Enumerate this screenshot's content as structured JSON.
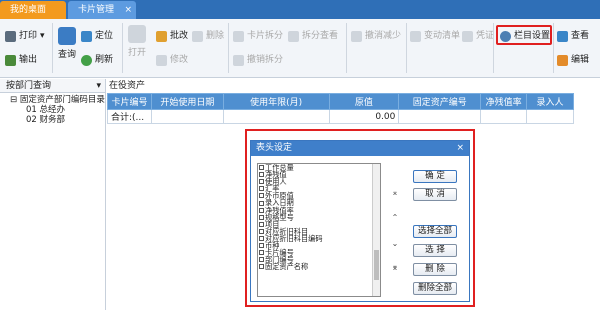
{
  "tabs": [
    {
      "label": "我的桌面"
    },
    {
      "label": "卡片管理",
      "close": "×"
    }
  ],
  "toolbar": {
    "print": "打印",
    "print_arrow": "▾",
    "output": "输出",
    "query": "查询",
    "locate": "定位",
    "refresh": "刷新",
    "open": "打开",
    "batch_edit": "批改",
    "modify": "修改",
    "delete": "删除",
    "card_split": "卡片拆分",
    "split_view": "拆分查看",
    "undo_split": "撤销拆分",
    "undo_reduce": "撤消减少",
    "change_list": "变动清单",
    "voucher": "凭证",
    "column_settings": "栏目设置",
    "view": "查看",
    "edit": "编辑"
  },
  "left_panel": {
    "dropdown": "按部门查询",
    "dropdown_arrow": "▾",
    "tree_root": "⊟ 固定资产部门编码目录",
    "tree_children": [
      "01 总经办",
      "02 财务部"
    ]
  },
  "main": {
    "caption": "在役资产",
    "columns": [
      "卡片编号",
      "开始使用日期",
      "使用年限(月)",
      "原值",
      "固定资产编号",
      "净残值率",
      "录入人"
    ],
    "total_row": {
      "label": "合计:(...",
      "value": "0.00"
    }
  },
  "dialog": {
    "title": "表头设定",
    "close": "×",
    "fields": [
      "工作总量",
      "净残值",
      "使用人",
      "汇率",
      "外币原值",
      "录入日期",
      "净残值率",
      "规格型号",
      "项目",
      "对应折旧科目",
      "对应折旧科目编码",
      "币种",
      "卡片编号",
      "部门编号",
      "固定资产名称"
    ],
    "arrows": {
      "top": "⌅",
      "up": "⌃",
      "down": "⌄",
      "bottom": "⌆"
    },
    "buttons": {
      "ok": "确  定",
      "cancel": "取  消",
      "select_all": "选择全部",
      "select": "选  择",
      "remove": "删  除",
      "remove_all": "删除全部"
    }
  }
}
